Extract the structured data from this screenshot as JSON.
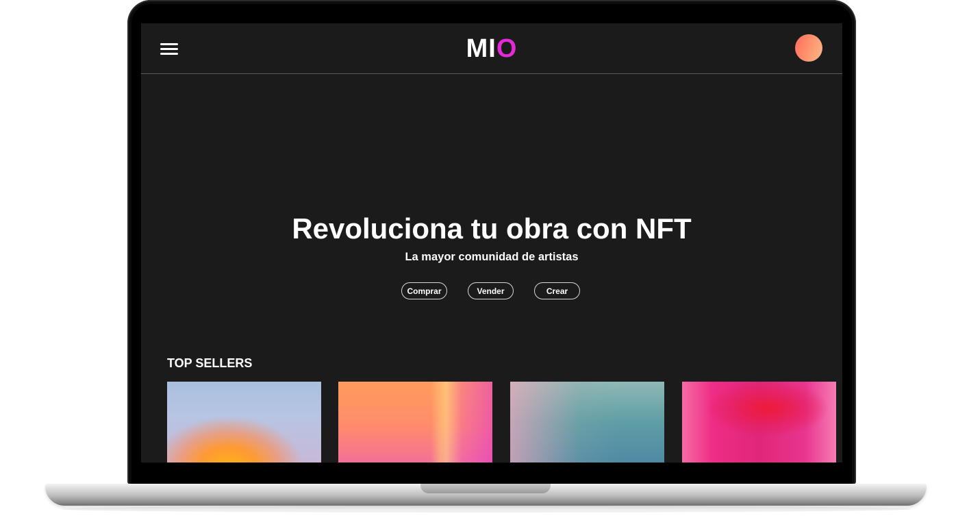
{
  "header": {
    "logo_main": "MI",
    "logo_accent": "O"
  },
  "hero": {
    "title": "Revoluciona tu obra con NFT",
    "subtitle": "La mayor comunidad de artistas",
    "buttons": [
      "Comprar",
      "Vender",
      "Crear"
    ]
  },
  "top_sellers": {
    "title": "TOP SELLERS"
  },
  "colors": {
    "background": "#1b1b1b",
    "accent": "#e32ad7",
    "text": "#ffffff"
  },
  "icons": {
    "menu": "hamburger-menu-icon",
    "profile": "avatar"
  }
}
